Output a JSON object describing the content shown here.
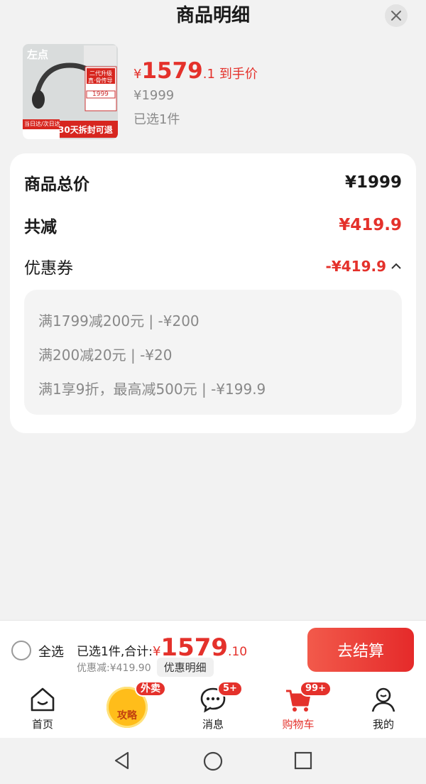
{
  "header": {
    "title": "商品明细"
  },
  "product": {
    "thumb_brand": "左点",
    "thumb_tags": [
      "二代升级",
      "真·骨传导"
    ],
    "thumb_price": "1999",
    "thumb_banner": "30天拆封可退",
    "thumb_ship": "当日达/次日达",
    "price_yen": "¥",
    "price_int": "1579",
    "price_dec": ".1",
    "price_suffix": "到手价",
    "original_price": "¥1999",
    "selected_count": "已选1件"
  },
  "summary": {
    "total_label": "商品总价",
    "total_value": "¥1999",
    "reduce_label": "共减",
    "reduce_value": "¥419.9",
    "coupon_label": "优惠券",
    "coupon_value": "-¥419.9",
    "coupons": [
      "满1799减200元 | -¥200",
      "满200减20元 | -¥20",
      "满1享9折，最高减500元 | -¥199.9"
    ]
  },
  "checkout_bar": {
    "select_all": "全选",
    "sum_prefix": "已选1件,合计:",
    "sum_yen": "¥",
    "sum_int": "1579",
    "sum_dec": ".10",
    "discount_text": "优惠减:¥419.90",
    "detail_button": "优惠明细",
    "checkout_button": "去结算"
  },
  "tabbar": {
    "home": "首页",
    "promo_label": "攻略",
    "promo_badge": "外卖",
    "messages": "消息",
    "messages_badge": "5+",
    "cart": "购物车",
    "cart_badge": "99+",
    "me": "我的"
  },
  "colors": {
    "accent": "#e4312b",
    "background": "#f2f2f2"
  }
}
